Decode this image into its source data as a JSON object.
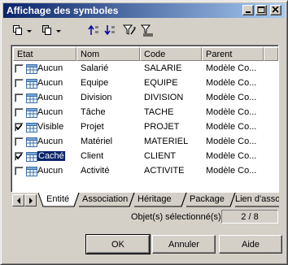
{
  "window": {
    "title": "Affichage des symboles"
  },
  "toolbar": {
    "tools": [
      {
        "name": "copy-dropdown-icon"
      },
      {
        "name": "paste-dropdown-icon"
      },
      {
        "name": "move-up-icon"
      },
      {
        "name": "move-down-icon"
      },
      {
        "name": "filter-icon"
      },
      {
        "name": "filter-clear-icon"
      }
    ]
  },
  "grid": {
    "columns": [
      "Etat",
      "Nom",
      "Code",
      "Parent"
    ],
    "rows": [
      {
        "checked": false,
        "etat": "Aucun",
        "nom": "Salarié",
        "code": "SALARIE",
        "parent": "Modèle Co..."
      },
      {
        "checked": false,
        "etat": "Aucun",
        "nom": "Equipe",
        "code": "EQUIPE",
        "parent": "Modèle Co..."
      },
      {
        "checked": false,
        "etat": "Aucun",
        "nom": "Division",
        "code": "DIVISION",
        "parent": "Modèle Co..."
      },
      {
        "checked": false,
        "etat": "Aucun",
        "nom": "Tâche",
        "code": "TACHE",
        "parent": "Modèle Co..."
      },
      {
        "checked": true,
        "etat": "Visible",
        "nom": "Projet",
        "code": "PROJET",
        "parent": "Modèle Co..."
      },
      {
        "checked": false,
        "etat": "Aucun",
        "nom": "Matériel",
        "code": "MATERIEL",
        "parent": "Modèle Co..."
      },
      {
        "checked": true,
        "etat": "Caché",
        "nom": "Client",
        "code": "CLIENT",
        "parent": "Modèle Co...",
        "selected": true
      },
      {
        "checked": false,
        "etat": "Aucun",
        "nom": "Activité",
        "code": "ACTIVITE",
        "parent": "Modèle Co..."
      }
    ]
  },
  "tabs": [
    "Entité",
    "Association",
    "Héritage",
    "Package",
    "Lien d'associa"
  ],
  "status": {
    "label": "Objet(s) sélectionné(s) :",
    "count": "2 / 8"
  },
  "buttons": {
    "ok": "OK",
    "cancel": "Annuler",
    "help": "Aide"
  },
  "colors": {
    "titlebar_start": "#0a246a",
    "titlebar_end": "#a6caf0",
    "face": "#d4d0c8",
    "selection": "#0a246a"
  }
}
